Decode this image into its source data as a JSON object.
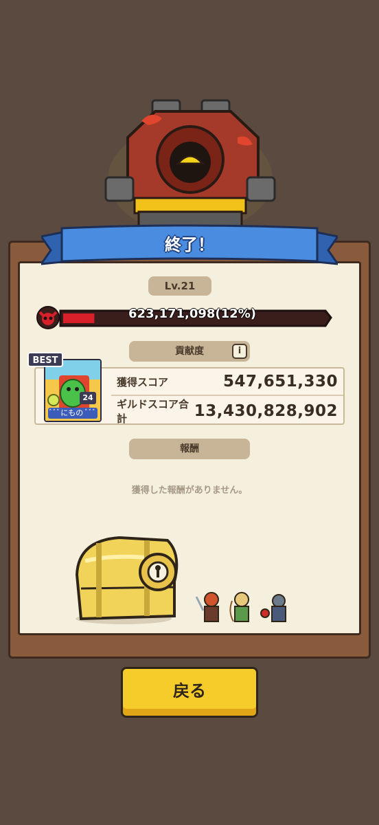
{
  "header": {
    "title": "終了！"
  },
  "boss": {
    "level": "Lv.21",
    "hp_text": "623,171,098(12%)",
    "hp_fraction": 0.12,
    "skull_icon": "demon-skull-icon"
  },
  "contribution": {
    "label": "貢献度",
    "info_icon": "i",
    "player": {
      "badge": "BEST",
      "level": "24",
      "name": "ﾞﾞﾞにもの ﾞﾞﾞ"
    },
    "rows": [
      {
        "label": "獲得スコア",
        "value": "547,651,330"
      },
      {
        "label": "ギルドスコア合計",
        "value": "13,430,828,902"
      }
    ]
  },
  "reward": {
    "label": "報酬",
    "empty_message": "獲得した報酬がありません。"
  },
  "back_button": {
    "label": "戻る"
  },
  "colors": {
    "background": "#5a4a40",
    "panel": "#f5efdd",
    "ribbon": "#3f7fd6",
    "hp_fill": "#d8202a",
    "button": "#f6cc2b"
  }
}
